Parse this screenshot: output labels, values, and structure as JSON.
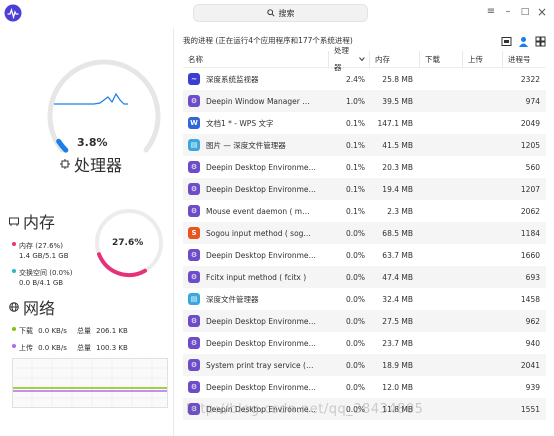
{
  "search": {
    "placeholder": "搜索"
  },
  "window": {
    "menu": "≡",
    "minimize": "–",
    "maximize": "□",
    "close": "×"
  },
  "cpu": {
    "percent": "3.8%",
    "title": "处理器",
    "percent_value": 3.8
  },
  "memory": {
    "title": "内存",
    "ring_percent": "27.6%",
    "mem_label": "内存 (27.6%)",
    "mem_value": "1.4 GB/5.1 GB",
    "swap_label": "交换空间 (0.0%)",
    "swap_value": "0.0 B/4.1 GB",
    "mem_fraction": 0.276,
    "mem_color": "#e8317b",
    "swap_color": "#26b8c8"
  },
  "network": {
    "title": "网络",
    "download_label": "下载",
    "download_rate": "0.0 KB/s",
    "download_total_label": "总量",
    "download_total": "206.1 KB",
    "upload_label": "上传",
    "upload_rate": "0.0 KB/s",
    "upload_total_label": "总量",
    "upload_total": "100.3 KB",
    "download_color": "#84c400",
    "upload_color": "#b26af0"
  },
  "process_panel": {
    "title": "我的进程 (正在运行4个应用程序和177个系统进程)",
    "columns": [
      "名称",
      "处理器",
      "内存",
      "下载",
      "上传",
      "进程号"
    ],
    "rows": [
      {
        "icon": "deepin-system-monitor-icon",
        "color": "#3b3fd0",
        "glyph": "~",
        "name": "深度系统监视器",
        "cpu": "2.4%",
        "mem": "25.8 MB",
        "dl": "",
        "ul": "",
        "pid": "2322"
      },
      {
        "icon": "deepin-gear-icon",
        "color": "#6c4cc8",
        "glyph": "⚙",
        "name": "Deepin Window Manager  …",
        "cpu": "1.0%",
        "mem": "39.5 MB",
        "dl": "",
        "ul": "",
        "pid": "974"
      },
      {
        "icon": "wps-writer-icon",
        "color": "#2f67d8",
        "glyph": "W",
        "name": "文档1 * - WPS 文字",
        "cpu": "0.1%",
        "mem": "147.1 MB",
        "dl": "",
        "ul": "",
        "pid": "2049"
      },
      {
        "icon": "deepin-file-manager-icon",
        "color": "#3aa8dd",
        "glyph": "▤",
        "name": "图片 — 深度文件管理器",
        "cpu": "0.1%",
        "mem": "41.5 MB",
        "dl": "",
        "ul": "",
        "pid": "1205"
      },
      {
        "icon": "deepin-gear-icon",
        "color": "#6c4cc8",
        "glyph": "⚙",
        "name": "Deepin Desktop Environme…",
        "cpu": "0.1%",
        "mem": "20.3 MB",
        "dl": "",
        "ul": "",
        "pid": "560"
      },
      {
        "icon": "deepin-gear-icon",
        "color": "#6c4cc8",
        "glyph": "⚙",
        "name": "Deepin Desktop Environme…",
        "cpu": "0.1%",
        "mem": "19.4 MB",
        "dl": "",
        "ul": "",
        "pid": "1207"
      },
      {
        "icon": "deepin-gear-icon",
        "color": "#6c4cc8",
        "glyph": "⚙",
        "name": "Mouse event daemon   ( m…",
        "cpu": "0.1%",
        "mem": "2.3 MB",
        "dl": "",
        "ul": "",
        "pid": "2062"
      },
      {
        "icon": "sogou-input-icon",
        "color": "#e8541c",
        "glyph": "S",
        "name": "Sogou input method    ( sog…",
        "cpu": "0.0%",
        "mem": "68.5 MB",
        "dl": "",
        "ul": "",
        "pid": "1184"
      },
      {
        "icon": "deepin-gear-icon",
        "color": "#6c4cc8",
        "glyph": "⚙",
        "name": "Deepin Desktop Environme…",
        "cpu": "0.0%",
        "mem": "63.7 MB",
        "dl": "",
        "ul": "",
        "pid": "1660"
      },
      {
        "icon": "deepin-gear-icon",
        "color": "#6c4cc8",
        "glyph": "⚙",
        "name": "Fcitx input method    ( fcitx )",
        "cpu": "0.0%",
        "mem": "47.4 MB",
        "dl": "",
        "ul": "",
        "pid": "693"
      },
      {
        "icon": "deepin-file-manager-icon",
        "color": "#3aa8dd",
        "glyph": "▤",
        "name": "深度文件管理器",
        "cpu": "0.0%",
        "mem": "32.4 MB",
        "dl": "",
        "ul": "",
        "pid": "1458"
      },
      {
        "icon": "deepin-gear-icon",
        "color": "#6c4cc8",
        "glyph": "⚙",
        "name": "Deepin Desktop Environme…",
        "cpu": "0.0%",
        "mem": "27.5 MB",
        "dl": "",
        "ul": "",
        "pid": "962"
      },
      {
        "icon": "deepin-gear-icon",
        "color": "#6c4cc8",
        "glyph": "⚙",
        "name": "Deepin Desktop Environme…",
        "cpu": "0.0%",
        "mem": "23.7 MB",
        "dl": "",
        "ul": "",
        "pid": "940"
      },
      {
        "icon": "deepin-gear-icon",
        "color": "#6c4cc8",
        "glyph": "⚙",
        "name": "System print tray service    (…",
        "cpu": "0.0%",
        "mem": "18.9 MB",
        "dl": "",
        "ul": "",
        "pid": "2041"
      },
      {
        "icon": "deepin-gear-icon",
        "color": "#6c4cc8",
        "glyph": "⚙",
        "name": "Deepin Desktop Environme…",
        "cpu": "0.0%",
        "mem": "12.0 MB",
        "dl": "",
        "ul": "",
        "pid": "939"
      },
      {
        "icon": "deepin-gear-icon",
        "color": "#6c4cc8",
        "glyph": "⚙",
        "name": "Deepin Desktop Environme…",
        "cpu": "0.0%",
        "mem": "11.8 MB",
        "dl": "",
        "ul": "",
        "pid": "1551"
      }
    ]
  },
  "watermark": "http://blog.csdn.net/qq_38434805"
}
